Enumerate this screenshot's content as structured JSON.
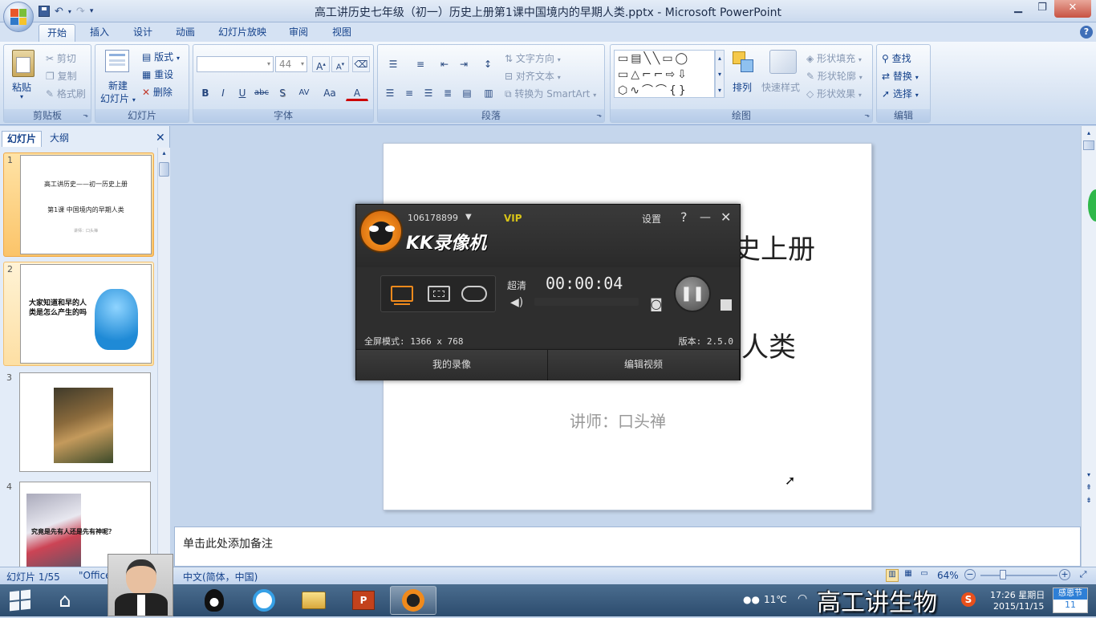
{
  "window": {
    "title": "高工讲历史七年级（初一）历史上册第1课中国境内的早期人类.pptx - Microsoft PowerPoint",
    "minimize": "▁",
    "restore": "❐",
    "close": "✕"
  },
  "ribbon_tabs": [
    "开始",
    "插入",
    "设计",
    "动画",
    "幻灯片放映",
    "审阅",
    "视图"
  ],
  "help": "?",
  "groups": {
    "clipboard": {
      "label": "剪贴板",
      "paste": "粘贴",
      "cut": "剪切",
      "copy": "复制",
      "format_painter": "格式刷"
    },
    "slides": {
      "label": "幻灯片",
      "new_slide": "新建",
      "new_slide2": "幻灯片",
      "layout": "版式",
      "reset": "重设",
      "delete": "删除"
    },
    "font": {
      "label": "字体",
      "size": "44",
      "bold": "B",
      "italic": "I",
      "underline": "U",
      "strike": "abc",
      "shadow": "S",
      "spacing": "AV",
      "case": "Aa",
      "color": "A",
      "grow": "A",
      "shrink": "A"
    },
    "paragraph": {
      "label": "段落",
      "text_direction": "文字方向",
      "align_text": "对齐文本",
      "smartart": "转换为 SmartArt"
    },
    "drawing": {
      "label": "绘图",
      "arrange": "排列",
      "quick_styles": "快速样式",
      "shape_fill": "形状填充",
      "shape_outline": "形状轮廓",
      "shape_effects": "形状效果"
    },
    "editing": {
      "label": "编辑",
      "find": "查找",
      "replace": "替换",
      "select": "选择"
    }
  },
  "panel_tabs": [
    "幻灯片",
    "大纲"
  ],
  "panel_close": "✕",
  "thumbnails": [
    {
      "num": "1",
      "line1": "高工讲历史——初一历史上册",
      "line2": "第1课 中国境内的早期人类",
      "line3": "讲师：口头禅"
    },
    {
      "num": "2",
      "text": "大家知道和早的人类是怎么产生的吗"
    },
    {
      "num": "3"
    },
    {
      "num": "4",
      "text": "究竟是先有人还是先有神呢？"
    }
  ],
  "slide": {
    "title_fragment": "史上册",
    "subtitle_fragment": "人类",
    "lecturer": "讲师：口头禅"
  },
  "notes_placeholder": "单击此处添加备注",
  "status": {
    "slide_count": "幻灯片 1/55",
    "theme": "\"Office",
    "language": "中文(简体，中国)",
    "zoom": "64%"
  },
  "kk_recorder": {
    "account": "106178899",
    "vip": "VIP",
    "settings": "设置",
    "help": "?",
    "minimize": "—",
    "close": "✕",
    "app_name": "KK录像机",
    "quality": "超清",
    "timer": "00:00:04",
    "mode": "全屏模式: 1366 x 768",
    "version": "版本: 2.5.0",
    "my_recordings": "我的录像",
    "edit_video": "编辑视频"
  },
  "taskbar": {
    "temperature": "11℃",
    "time": "17:26 星期日",
    "date": "2015/11/15",
    "festival": "感恩节",
    "festival_day": "11"
  },
  "watermark": "高工讲生物",
  "colors": {
    "office_blue": "#15428b",
    "ribbon_bg": "#dbe6f4",
    "selected_thumb": "#fbc469",
    "kk_bg": "#2b2b2b",
    "kk_accent": "#f08a1c",
    "vip": "#d8c418"
  }
}
